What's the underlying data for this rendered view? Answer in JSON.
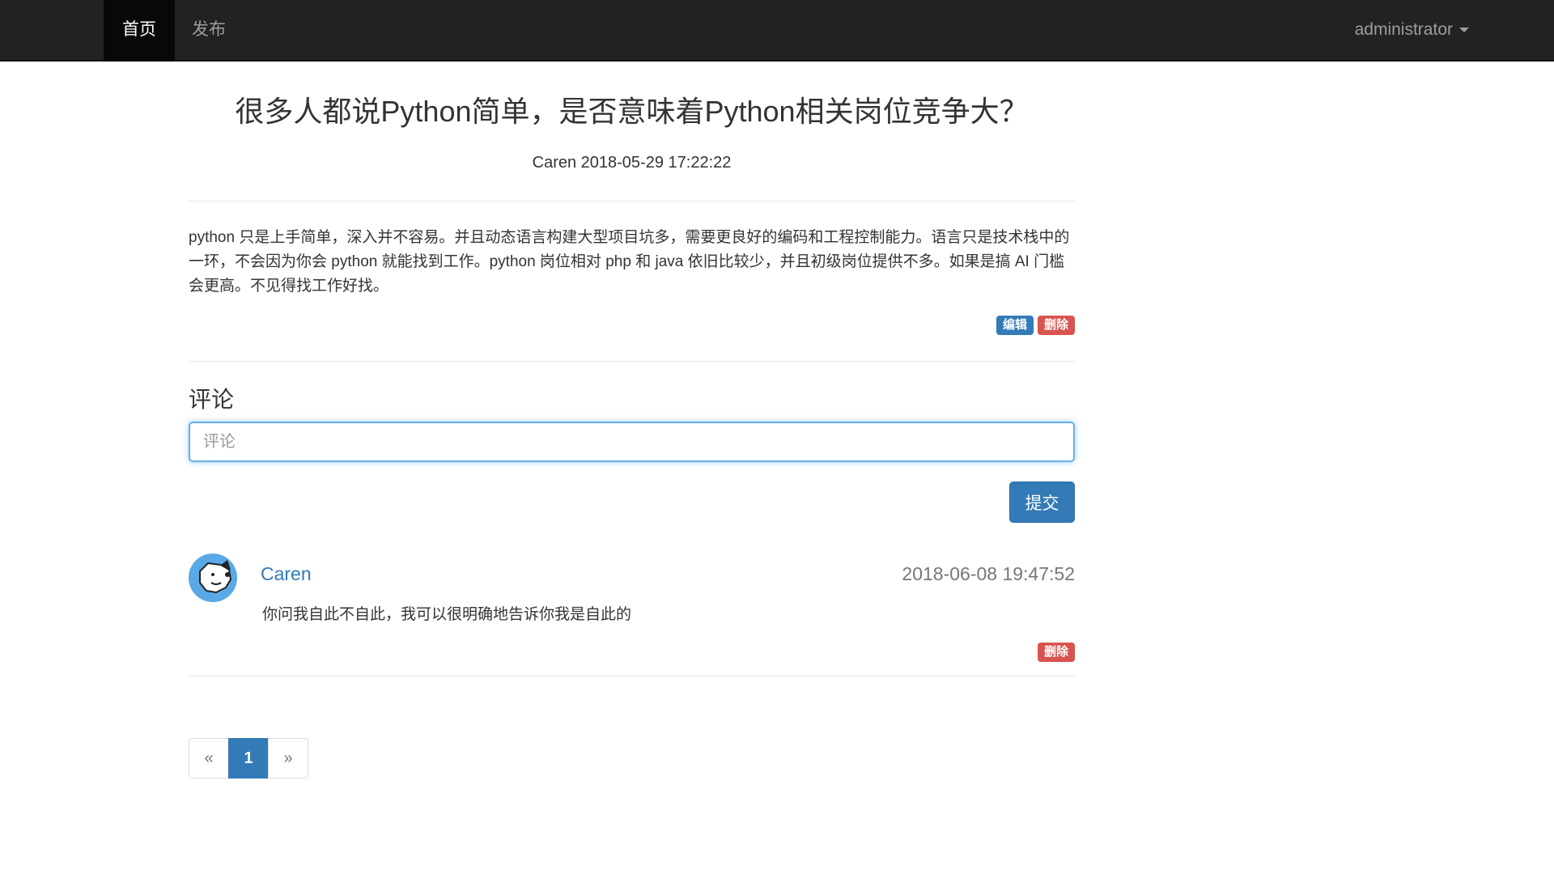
{
  "navbar": {
    "home_label": "首页",
    "publish_label": "发布",
    "user_label": "administrator"
  },
  "post": {
    "title": "很多人都说Python简单，是否意味着Python相关岗位竞争大？",
    "meta": "Caren 2018-05-29 17:22:22",
    "body": "python 只是上手简单，深入并不容易。并且动态语言构建大型项目坑多，需要更良好的编码和工程控制能力。语言只是技术栈中的一环，不会因为你会 python 就能找到工作。python 岗位相对 php 和 java 依旧比较少，并且初级岗位提供不多。如果是搞 AI 门槛会更高。不见得找工作好找。",
    "edit_label": "编辑",
    "delete_label": "删除"
  },
  "comments_section": {
    "heading": "评论",
    "input_placeholder": "评论",
    "input_value": "",
    "submit_label": "提交",
    "items": [
      {
        "author": "Caren",
        "time": "2018-06-08 19:47:52",
        "text": "你问我自此不自此，我可以很明确地告诉你我是自此的",
        "delete_label": "删除"
      }
    ]
  },
  "pagination": {
    "prev_label": "«",
    "current_page": "1",
    "next_label": "»"
  },
  "colors": {
    "navbar_bg": "#222222",
    "primary": "#337ab7",
    "danger": "#d9534f",
    "muted": "#777777"
  }
}
